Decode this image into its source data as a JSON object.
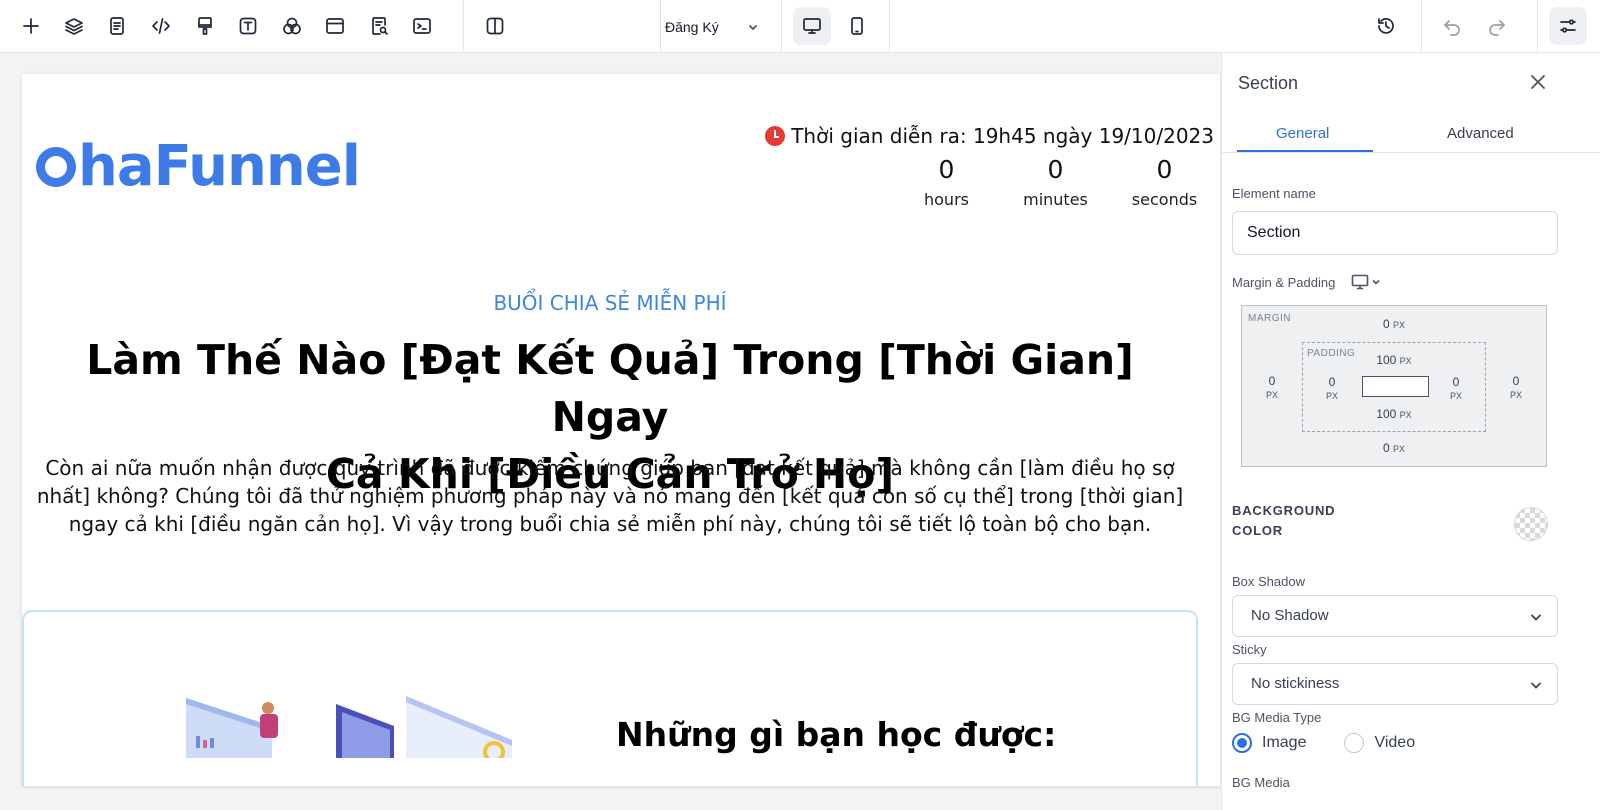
{
  "toolbar": {
    "tools": [
      {
        "name": "add-icon"
      },
      {
        "name": "layers-icon"
      },
      {
        "name": "pages-icon"
      },
      {
        "name": "code-icon"
      },
      {
        "name": "paint-icon"
      },
      {
        "name": "text-icon"
      },
      {
        "name": "shapes-icon"
      },
      {
        "name": "browser-icon"
      },
      {
        "name": "seo-icon"
      },
      {
        "name": "terminal-icon"
      },
      {
        "name": "columns-icon"
      }
    ],
    "page_select": "Đăng Ký",
    "devices": {
      "desktop": "desktop-icon",
      "mobile": "mobile-icon"
    },
    "right_tools": [
      "history-icon",
      "undo-icon",
      "redo-icon",
      "settings-sliders-icon"
    ]
  },
  "canvas": {
    "logo": "haFunnel",
    "event_time": "Thời gian diễn ra: 19h45 ngày 19/10/2023",
    "countdown": [
      {
        "value": "0",
        "label": "hours"
      },
      {
        "value": "0",
        "label": "minutes"
      },
      {
        "value": "0",
        "label": "seconds"
      }
    ],
    "eyebrow": "BUỔI CHIA SẺ MIỄN PHÍ",
    "headline_line1": "Làm Thế Nào [Đạt Kết Quả] Trong [Thời Gian] Ngay",
    "headline_line2": "Cả Khi [Điều Cản Trở Họ]",
    "description": "Còn ai nữa muốn nhận được quy trình đã được kiểm chứng giúp bạn [đạt kết quả] mà không cần [làm điều họ sợ nhất] không? Chúng tôi đã thử nghiệm phương pháp này và nó mang đến [kết quả con số cụ thể] trong [thời gian] ngay cả khi [điều ngăn cản họ]. Vì vậy trong buổi chia sẻ miễn phí này, chúng tôi sẽ tiết lộ toàn bộ cho bạn.",
    "learn_title": "Những gì bạn học được:"
  },
  "panel": {
    "title": "Section",
    "tabs": {
      "general": "General",
      "advanced": "Advanced"
    },
    "element_name_label": "Element name",
    "element_name_value": "Section",
    "margin_padding_label": "Margin & Padding",
    "box_model": {
      "margin_label": "MARGIN",
      "padding_label": "PADDING",
      "margin_top": "0",
      "margin_bottom": "0",
      "margin_left": "0",
      "margin_right": "0",
      "padding_top": "100",
      "padding_bottom": "100",
      "padding_left": "0",
      "padding_right": "0",
      "unit": "PX"
    },
    "bg_color_line1": "BACKGROUND",
    "bg_color_line2": "COLOR",
    "box_shadow_label": "Box Shadow",
    "box_shadow_value": "No Shadow",
    "sticky_label": "Sticky",
    "sticky_value": "No stickiness",
    "bg_media_type_label": "BG Media Type",
    "bg_media_options": {
      "image": "Image",
      "video": "Video"
    },
    "bg_media_selected": "Image",
    "bg_media_label": "BG Media"
  },
  "colors": {
    "accent": "#2d6fe0",
    "logo": "#3d7be6",
    "eyebrow": "#3d87e0",
    "clock": "#e53935",
    "border_highlight": "#bfe3f3"
  }
}
